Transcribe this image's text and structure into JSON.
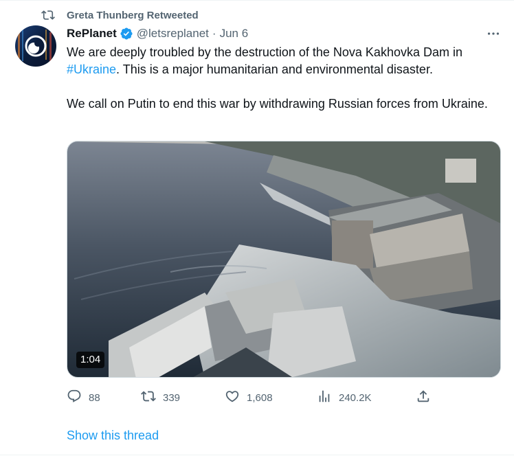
{
  "retweet": {
    "label": "Greta Thunberg Retweeted",
    "icon": "retweet-icon"
  },
  "author": {
    "name": "RePlanet",
    "verified_icon": "verified-badge-icon",
    "handle": "@letsreplanet",
    "separator": "·",
    "date": "Jun 6"
  },
  "more_icon": "more-options-icon",
  "tweet": {
    "line1_prefix": "We are deeply troubled by the destruction of the Nova Kakhovka Dam in",
    "hashtag": "#Ukraine",
    "line1_suffix": ". This is a major humanitarian and environmental disaster.",
    "paragraph2": "We call on Putin to end this war by withdrawing Russian forces from Ukraine."
  },
  "media": {
    "duration": "1:04"
  },
  "actions": {
    "reply": {
      "icon": "reply-icon",
      "count": "88"
    },
    "retweet": {
      "icon": "retweet-icon",
      "count": "339"
    },
    "like": {
      "icon": "heart-icon",
      "count": "1,608"
    },
    "views": {
      "icon": "views-chart-icon",
      "count": "240.2K"
    },
    "share": {
      "icon": "share-icon"
    }
  },
  "show_thread": "Show this thread",
  "colors": {
    "accent": "#1d9bf0",
    "muted": "#536471",
    "text": "#0f1419"
  }
}
